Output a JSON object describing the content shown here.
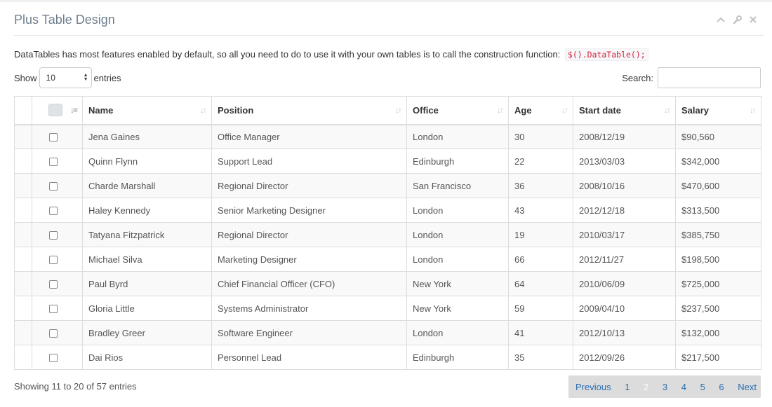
{
  "panel": {
    "title": "Plus Table Design",
    "tools": [
      "chevron-up-icon",
      "wrench-icon",
      "close-icon"
    ]
  },
  "description": {
    "text": "DataTables has most features enabled by default, so all you need to do to use it with your own tables is to call the construction function:",
    "code": "$().DataTable();"
  },
  "length": {
    "show_label": "Show",
    "value": "10",
    "entries_label": "entries"
  },
  "search": {
    "label": "Search:",
    "value": ""
  },
  "table": {
    "columns": [
      "Name",
      "Position",
      "Office",
      "Age",
      "Start date",
      "Salary"
    ],
    "rows": [
      [
        "Jena Gaines",
        "Office Manager",
        "London",
        "30",
        "2008/12/19",
        "$90,560"
      ],
      [
        "Quinn Flynn",
        "Support Lead",
        "Edinburgh",
        "22",
        "2013/03/03",
        "$342,000"
      ],
      [
        "Charde Marshall",
        "Regional Director",
        "San Francisco",
        "36",
        "2008/10/16",
        "$470,600"
      ],
      [
        "Haley Kennedy",
        "Senior Marketing Designer",
        "London",
        "43",
        "2012/12/18",
        "$313,500"
      ],
      [
        "Tatyana Fitzpatrick",
        "Regional Director",
        "London",
        "19",
        "2010/03/17",
        "$385,750"
      ],
      [
        "Michael Silva",
        "Marketing Designer",
        "London",
        "66",
        "2012/11/27",
        "$198,500"
      ],
      [
        "Paul Byrd",
        "Chief Financial Officer (CFO)",
        "New York",
        "64",
        "2010/06/09",
        "$725,000"
      ],
      [
        "Gloria Little",
        "Systems Administrator",
        "New York",
        "59",
        "2009/04/10",
        "$237,500"
      ],
      [
        "Bradley Greer",
        "Software Engineer",
        "London",
        "41",
        "2012/10/13",
        "$132,000"
      ],
      [
        "Dai Rios",
        "Personnel Lead",
        "Edinburgh",
        "35",
        "2012/09/26",
        "$217,500"
      ]
    ]
  },
  "info": "Showing 11 to 20 of 57 entries",
  "pagination": {
    "previous": "Previous",
    "pages": [
      "1",
      "2",
      "3",
      "4",
      "5",
      "6"
    ],
    "current": "2",
    "next": "Next"
  }
}
